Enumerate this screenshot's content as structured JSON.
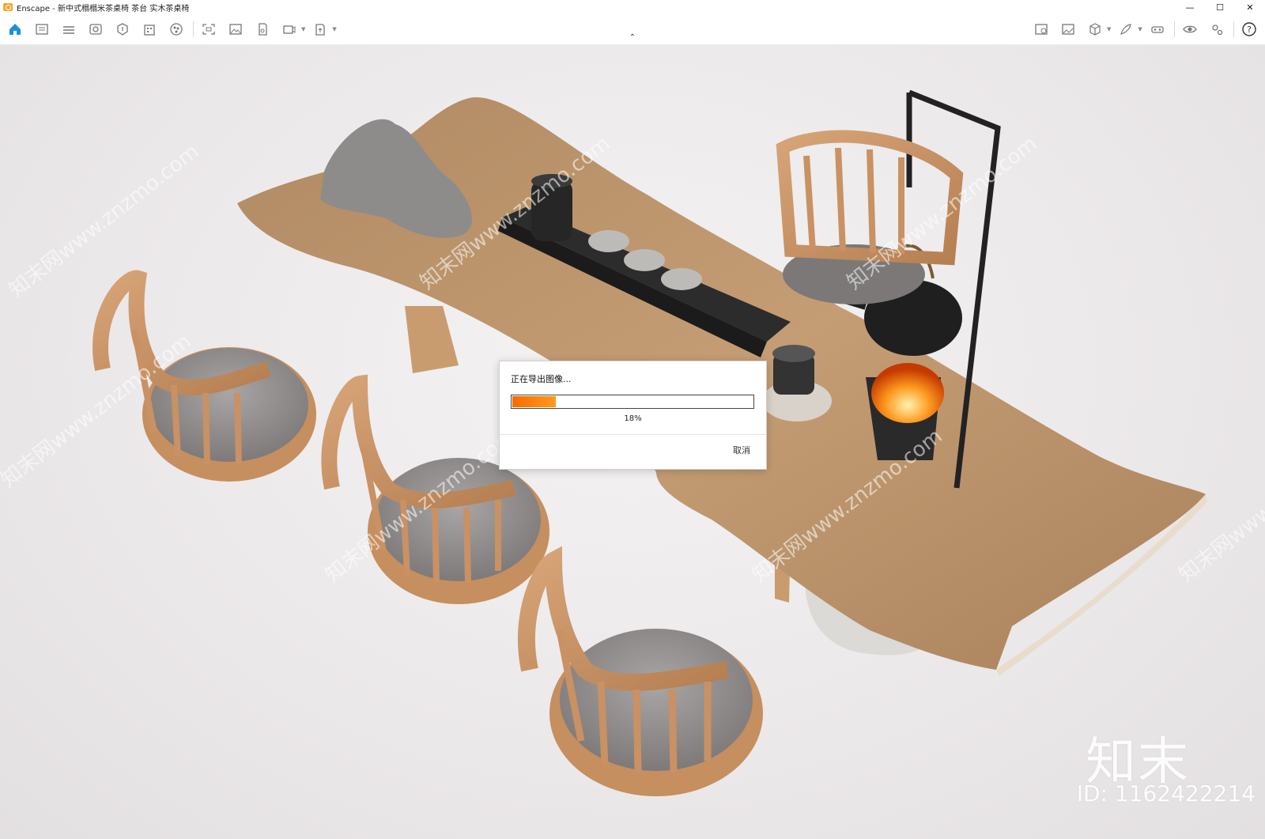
{
  "window": {
    "app_name": "Enscape",
    "title": "Enscape - 新中式榻榻米茶桌椅 茶台 实木茶桌椅",
    "controls": {
      "minimize": "—",
      "maximize": "☐",
      "close": "✕"
    }
  },
  "toolbar": {
    "left_icons": [
      "home-icon",
      "sidebar-icon",
      "bim-icon",
      "visual-settings-icon",
      "asset-library-icon",
      "building-icon",
      "material-icon",
      "screenshot-icon",
      "image-export-icon",
      "batch-render-icon",
      "video-export-icon",
      "upload-icon"
    ],
    "right_icons": [
      "site-context-icon",
      "gallery-icon",
      "box-icon",
      "feather-icon",
      "vr-icon",
      "eye-icon",
      "settings-icon",
      "help-icon"
    ],
    "accent_color": "#1f8fd6",
    "collapse_symbol": "⌃"
  },
  "viewport": {
    "background_color": "#ebe8e9"
  },
  "watermark": {
    "logo_text": "知末",
    "id_text": "ID: 1162422214",
    "diagonal_text": "知末网www.znzmo.com"
  },
  "export_dialog": {
    "title": "正在导出图像...",
    "progress": 0.18,
    "progress_text": "18%",
    "cancel_label": "取消",
    "progress_color_start": "#f56b00",
    "progress_color_end": "#ff9a1f"
  }
}
